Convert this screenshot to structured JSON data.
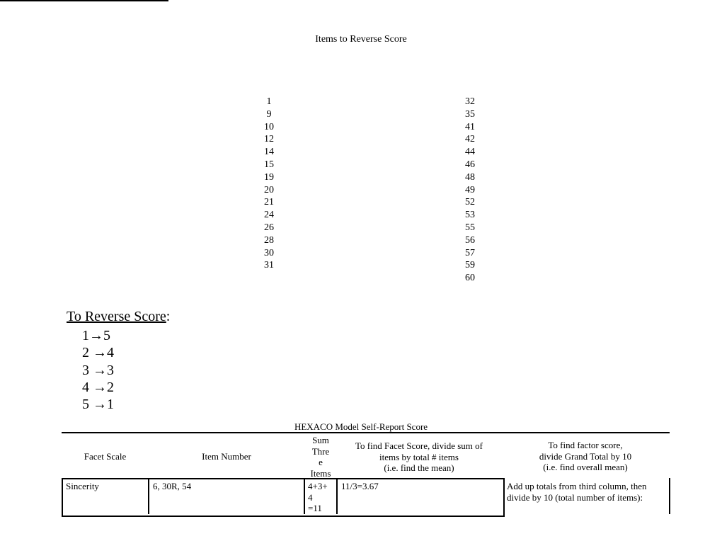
{
  "title": "Items to Reverse Score",
  "reverse_items": {
    "left_column": [
      "1",
      "9",
      "10",
      "12",
      "14",
      "15",
      "19",
      "20",
      "21",
      "24",
      "26",
      "28",
      "30",
      "31"
    ],
    "right_column": [
      "32",
      "35",
      "41",
      "42",
      "44",
      "46",
      "48",
      "49",
      "52",
      "53",
      "55",
      "56",
      "57",
      "59",
      "60"
    ]
  },
  "reverse_rule": {
    "heading": "To Reverse Score",
    "heading_suffix": ":",
    "mappings": [
      "1→5",
      "2 →4",
      "3 →3",
      "4 →2",
      "5 →1"
    ]
  },
  "score_table": {
    "title": "HEXACO Model Self-Report Score",
    "headers": [
      "Facet Scale",
      "Item Number",
      "Sum\nThre\ne\nItems",
      "To find Facet Score, divide sum of\nitems by total # items\n(i.e. find the mean)",
      "To find factor score,\ndivide Grand Total by 10\n(i.e. find overall mean)"
    ],
    "rows": [
      {
        "facet": "Sincerity",
        "items": "6, 30R, 54",
        "sum": "4+3+\n4\n=11",
        "facet_score": "11/3=3.67",
        "factor_note": "Add up totals from third column, then\ndivide by 10 (total number of items):"
      }
    ]
  }
}
